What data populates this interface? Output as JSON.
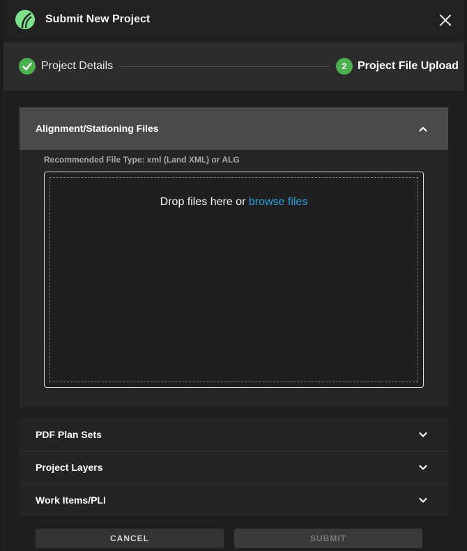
{
  "dialog": {
    "title": "Submit New Project",
    "logo_icon": "leaf-logo",
    "close_icon": "close-icon"
  },
  "stepper": {
    "steps": [
      {
        "label": "Project Details",
        "state": "completed",
        "icon": "check-circle-icon"
      },
      {
        "label": "Project File Upload",
        "state": "active",
        "number": "2"
      }
    ]
  },
  "sections": {
    "alignment": {
      "title": "Alignment/Stationing Files",
      "expanded": true,
      "hint": "Recommended File Type: xml (Land XML) or ALG",
      "drop_text": "Drop files here or",
      "browse_link": "browse files"
    },
    "collapsed": [
      {
        "title": "PDF Plan Sets"
      },
      {
        "title": "Project Layers"
      },
      {
        "title": "Work Items/PLI"
      }
    ]
  },
  "actions": {
    "cancel_label": "CANCEL",
    "submit_label": "SUBMIT",
    "submit_disabled": true
  },
  "colors": {
    "accent_green": "#4caf50",
    "logo_green": "#7ee08a",
    "link_blue": "#2aa3e0",
    "background": "#1f1f1f"
  }
}
